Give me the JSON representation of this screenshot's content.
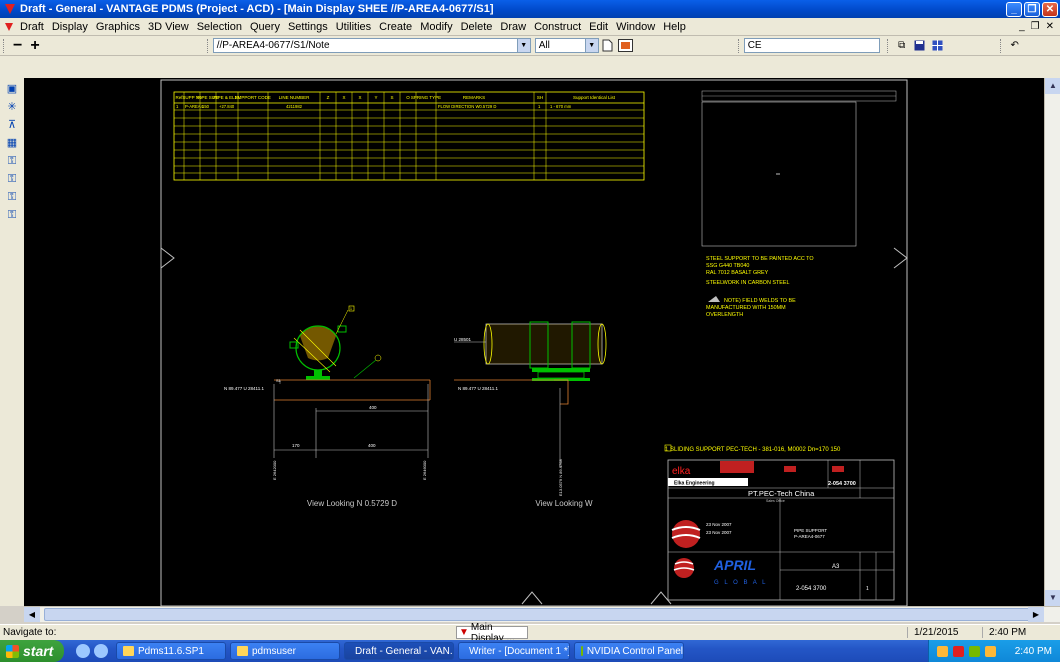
{
  "window": {
    "title": "Draft - General - VANTAGE PDMS (Project - ACD) - [Main Display   SHEE  //P-AREA4-0677/S1]",
    "minimize": "_",
    "maximize": "❐",
    "close": "✕"
  },
  "menu": {
    "items": [
      "Draft",
      "Display",
      "Graphics",
      "3D View",
      "Selection",
      "Query",
      "Settings",
      "Utilities",
      "Create",
      "Modify",
      "Delete",
      "Draw",
      "Construct",
      "Edit",
      "Window",
      "Help"
    ],
    "right_controls": [
      "_",
      "❐",
      "✕"
    ]
  },
  "toolbar": {
    "minus": "−",
    "plus": "+",
    "path_combo": "//P-AREA4-0677/S1/Note",
    "filter_combo": "All",
    "ce_combo": "CE"
  },
  "drawing": {
    "sheet_no_label": "SHEE",
    "table_headers": [
      "Ref",
      "SUPP No",
      "PIPE SIZE",
      "PIPE & ELEV",
      "SUPPORT CODE",
      "LINE NUMBER",
      "Z",
      "X",
      "X",
      "Y",
      "S",
      "O",
      "SPRING TYPE",
      "REMARKS",
      "SH",
      "Support Identical List"
    ],
    "table_row1": [
      "1",
      "P-AREA4",
      "150",
      "+27.840",
      "",
      "4211982",
      "",
      "",
      "",
      "",
      "",
      "",
      "",
      "FLOW DIRECTION W0.5729 D",
      "1",
      "1 - 670 mm"
    ],
    "notes": [
      "STEEL SUPPORT TO BE PAINTED ACC TO",
      "SSG G440 TB040",
      "RAL 7012 BASALT GREY",
      "STEELWORK IN CARBON STEEL"
    ],
    "weld_note": [
      "NOTE) FIELD WELDS TO BE",
      "MANUFACTURED WITH 150MM",
      "OVERLENGTH"
    ],
    "bom_line": "1    SLIDING SUPPORT PEC-TECH - 381-016, M0002 Dn=170    150",
    "dim_left_elev": "N 89.477 U 28411.1",
    "dim_right_elev": "N 89.477 U 28411.1",
    "dim_400_top": "400",
    "dim_170": "170",
    "dim_400_bottom": "400",
    "dim_pipe_label": "U 28501",
    "dim_v_left_a": "E 2642000",
    "dim_v_left_b": "E 2646000",
    "dim_v_right": "E13.0579 N 89.4768",
    "view_left": "View Looking N 0.5729 D",
    "view_right": "View Looking W",
    "tb_company": "PT.PEC-Tech China",
    "tb_company_sub": "Sales Office",
    "tb_elka": "elka",
    "tb_elka_eng": "Elka Engineering",
    "tb_docno_top": "2-054 3700",
    "tb_title1": "PIPE SUPPORT",
    "tb_title2": "P-AREA4-0677",
    "tb_date1": "23 Nov 2007",
    "tb_date2": "23 Nov 2007",
    "tb_client": "APRIL",
    "tb_client_sub": "G L O B A L",
    "tb_scale": "A3",
    "tb_docno": "2-054 3700",
    "tb_sheet": "1",
    "tb_marker1": "1",
    "tb_marker2": "1"
  },
  "status": {
    "navigate": "Navigate to:",
    "task": "Main Display ...",
    "date": "1/21/2015",
    "time": "2:40 PM"
  },
  "taskbar": {
    "start": "start",
    "buttons": [
      "Pdms11.6.SP1",
      "pdmsuser",
      "Draft - General - VAN...",
      "Writer - [Document 1 *]",
      "NVIDIA Control Panel"
    ],
    "clock": "2:40 PM"
  },
  "colors": {
    "accent": "#0a5fe8",
    "drawing_yellow": "#ffff00",
    "drawing_green": "#00c000",
    "drawing_red": "#ff2020"
  }
}
